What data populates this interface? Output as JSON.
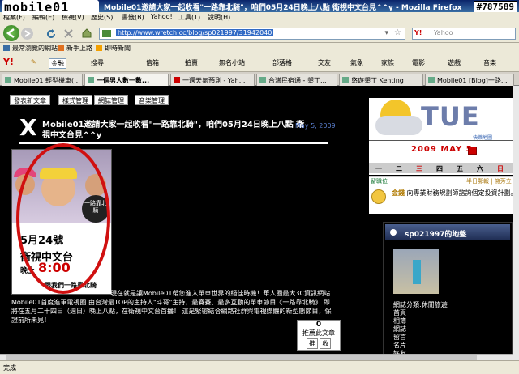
{
  "window": {
    "logo_text": "mobile01",
    "title": "Mobile01邀請大家一起收看\"一路靠北騎\"，咱們05月24日晚上八點 衛視中文台見^^y - Mozilla Firefox",
    "badge": "#787589"
  },
  "menu": [
    "檔案(F)",
    "編輯(E)",
    "檢視(V)",
    "歷史(S)",
    "書籤(B)",
    "Yahoo!",
    "工具(T)",
    "說明(H)"
  ],
  "nav": {
    "url": "http://www.wretch.cc/blog/sp021997/31942040",
    "search_placeholder": "Yahoo",
    "search_brand": "Y!"
  },
  "bookmarks": [
    "最常瀏覽的網站",
    "新手上路",
    "即時新聞"
  ],
  "yahoo_toolbar": {
    "brand": "Y!",
    "dropdown": "金融",
    "items": [
      "搜尋",
      "信箱",
      "拍賣",
      "無名小站",
      "部落格",
      "交友",
      "氣象",
      "家族",
      "電影",
      "遊戲",
      "音樂"
    ]
  },
  "tabs": [
    {
      "label": "Mobile01 輕型機車(...",
      "active": false
    },
    {
      "label": "一個男人數一數...",
      "active": true
    },
    {
      "label": "一週天氣預測 - Yah...",
      "active": false
    },
    {
      "label": "台灣民宿通 - 墾丁...",
      "active": false
    },
    {
      "label": "悠遊墾丁 Kenting",
      "active": false
    },
    {
      "label": "Mobile01 [Blog]一路...",
      "active": false
    }
  ],
  "blog": {
    "nav_buttons": [
      "發表新文章",
      "樣式管理",
      "網誌管理",
      "音樂管理"
    ],
    "post_marker": "X",
    "post_title": "Mobile01邀請大家一起收看\"一路靠北騎\"，咱們05月24日晚上八點 衛視中文台見^^y",
    "post_date": "May 5, 2009",
    "poster": {
      "logo": "一路靠北騎",
      "date": "5月24號",
      "channel": "衛視中文台",
      "time_prefix": "晚上",
      "time": "8:00",
      "tagline": "跟我們一路靠北騎"
    },
    "body_first": "現在就是讓Mobile01帶您進入單車世界的絕佳時機！華人圈最大3C資訊網站",
    "body_rest": "Mobile01首度進軍電視圈 由台灣最TOP的主持人\"斗哥\"主持，最賽賽、最多互動的單車節目《一路靠北騎》 即將在五月二十四日（週日）晚上八點，在衛視中文台首播！ 這是緊密結合網路社群與電視媒體的新型態節目，保證前所未見！",
    "recommend": {
      "count": "0",
      "label": "推薦此文章",
      "push": "推",
      "collect": "收"
    }
  },
  "sidebar": {
    "day": "TUE",
    "weather_source": "快樂地圖",
    "date": "2009 MAY 5",
    "week_days": [
      "一",
      "二",
      "三",
      "四",
      "五",
      "六",
      "日"
    ],
    "msg_top_left": "留職位",
    "msg_top_right": "半日郵報 | 擁芳立",
    "msg_name": "金錢",
    "msg_text": "向專業財務規劃師諮詢個定投資計劃。",
    "panel_title": "sp021997的地盤",
    "panel_links": [
      "網誌分類:休閒旅遊",
      "首頁",
      "相簿",
      "網誌",
      "留言",
      "名片",
      "好友"
    ]
  },
  "status": "完成"
}
